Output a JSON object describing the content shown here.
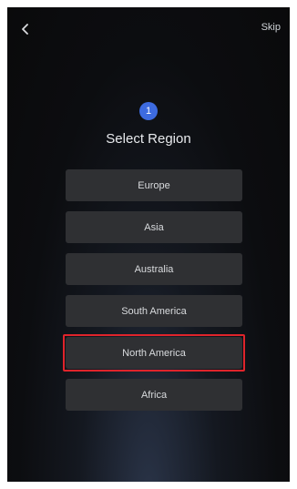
{
  "header": {
    "back_icon": "chevron-left-icon",
    "skip_label": "Skip"
  },
  "step": {
    "number": "1"
  },
  "title": "Select Region",
  "regions": [
    {
      "label": "Europe"
    },
    {
      "label": "Asia"
    },
    {
      "label": "Australia"
    },
    {
      "label": "South America"
    },
    {
      "label": "North America",
      "highlighted": true
    },
    {
      "label": "Africa"
    }
  ],
  "colors": {
    "accent": "#3d6be0",
    "highlight": "#e0242b",
    "button_bg": "#2f3033"
  }
}
